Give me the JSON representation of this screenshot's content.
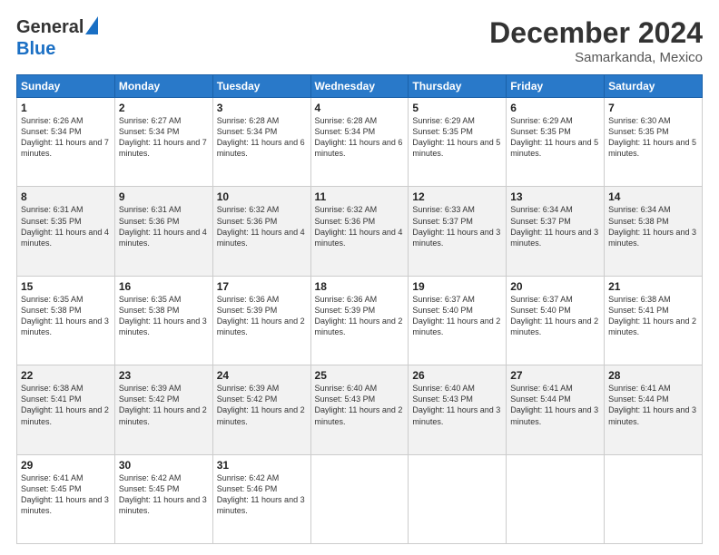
{
  "logo": {
    "line1": "General",
    "line2": "Blue"
  },
  "title": "December 2024",
  "subtitle": "Samarkanda, Mexico",
  "days_header": [
    "Sunday",
    "Monday",
    "Tuesday",
    "Wednesday",
    "Thursday",
    "Friday",
    "Saturday"
  ],
  "weeks": [
    [
      {
        "day": "1",
        "sunrise": "6:26 AM",
        "sunset": "5:34 PM",
        "daylight": "11 hours and 7 minutes."
      },
      {
        "day": "2",
        "sunrise": "6:27 AM",
        "sunset": "5:34 PM",
        "daylight": "11 hours and 7 minutes."
      },
      {
        "day": "3",
        "sunrise": "6:28 AM",
        "sunset": "5:34 PM",
        "daylight": "11 hours and 6 minutes."
      },
      {
        "day": "4",
        "sunrise": "6:28 AM",
        "sunset": "5:34 PM",
        "daylight": "11 hours and 6 minutes."
      },
      {
        "day": "5",
        "sunrise": "6:29 AM",
        "sunset": "5:35 PM",
        "daylight": "11 hours and 5 minutes."
      },
      {
        "day": "6",
        "sunrise": "6:29 AM",
        "sunset": "5:35 PM",
        "daylight": "11 hours and 5 minutes."
      },
      {
        "day": "7",
        "sunrise": "6:30 AM",
        "sunset": "5:35 PM",
        "daylight": "11 hours and 5 minutes."
      }
    ],
    [
      {
        "day": "8",
        "sunrise": "6:31 AM",
        "sunset": "5:35 PM",
        "daylight": "11 hours and 4 minutes."
      },
      {
        "day": "9",
        "sunrise": "6:31 AM",
        "sunset": "5:36 PM",
        "daylight": "11 hours and 4 minutes."
      },
      {
        "day": "10",
        "sunrise": "6:32 AM",
        "sunset": "5:36 PM",
        "daylight": "11 hours and 4 minutes."
      },
      {
        "day": "11",
        "sunrise": "6:32 AM",
        "sunset": "5:36 PM",
        "daylight": "11 hours and 4 minutes."
      },
      {
        "day": "12",
        "sunrise": "6:33 AM",
        "sunset": "5:37 PM",
        "daylight": "11 hours and 3 minutes."
      },
      {
        "day": "13",
        "sunrise": "6:34 AM",
        "sunset": "5:37 PM",
        "daylight": "11 hours and 3 minutes."
      },
      {
        "day": "14",
        "sunrise": "6:34 AM",
        "sunset": "5:38 PM",
        "daylight": "11 hours and 3 minutes."
      }
    ],
    [
      {
        "day": "15",
        "sunrise": "6:35 AM",
        "sunset": "5:38 PM",
        "daylight": "11 hours and 3 minutes."
      },
      {
        "day": "16",
        "sunrise": "6:35 AM",
        "sunset": "5:38 PM",
        "daylight": "11 hours and 3 minutes."
      },
      {
        "day": "17",
        "sunrise": "6:36 AM",
        "sunset": "5:39 PM",
        "daylight": "11 hours and 2 minutes."
      },
      {
        "day": "18",
        "sunrise": "6:36 AM",
        "sunset": "5:39 PM",
        "daylight": "11 hours and 2 minutes."
      },
      {
        "day": "19",
        "sunrise": "6:37 AM",
        "sunset": "5:40 PM",
        "daylight": "11 hours and 2 minutes."
      },
      {
        "day": "20",
        "sunrise": "6:37 AM",
        "sunset": "5:40 PM",
        "daylight": "11 hours and 2 minutes."
      },
      {
        "day": "21",
        "sunrise": "6:38 AM",
        "sunset": "5:41 PM",
        "daylight": "11 hours and 2 minutes."
      }
    ],
    [
      {
        "day": "22",
        "sunrise": "6:38 AM",
        "sunset": "5:41 PM",
        "daylight": "11 hours and 2 minutes."
      },
      {
        "day": "23",
        "sunrise": "6:39 AM",
        "sunset": "5:42 PM",
        "daylight": "11 hours and 2 minutes."
      },
      {
        "day": "24",
        "sunrise": "6:39 AM",
        "sunset": "5:42 PM",
        "daylight": "11 hours and 2 minutes."
      },
      {
        "day": "25",
        "sunrise": "6:40 AM",
        "sunset": "5:43 PM",
        "daylight": "11 hours and 2 minutes."
      },
      {
        "day": "26",
        "sunrise": "6:40 AM",
        "sunset": "5:43 PM",
        "daylight": "11 hours and 3 minutes."
      },
      {
        "day": "27",
        "sunrise": "6:41 AM",
        "sunset": "5:44 PM",
        "daylight": "11 hours and 3 minutes."
      },
      {
        "day": "28",
        "sunrise": "6:41 AM",
        "sunset": "5:44 PM",
        "daylight": "11 hours and 3 minutes."
      }
    ],
    [
      {
        "day": "29",
        "sunrise": "6:41 AM",
        "sunset": "5:45 PM",
        "daylight": "11 hours and 3 minutes."
      },
      {
        "day": "30",
        "sunrise": "6:42 AM",
        "sunset": "5:45 PM",
        "daylight": "11 hours and 3 minutes."
      },
      {
        "day": "31",
        "sunrise": "6:42 AM",
        "sunset": "5:46 PM",
        "daylight": "11 hours and 3 minutes."
      },
      null,
      null,
      null,
      null
    ]
  ]
}
